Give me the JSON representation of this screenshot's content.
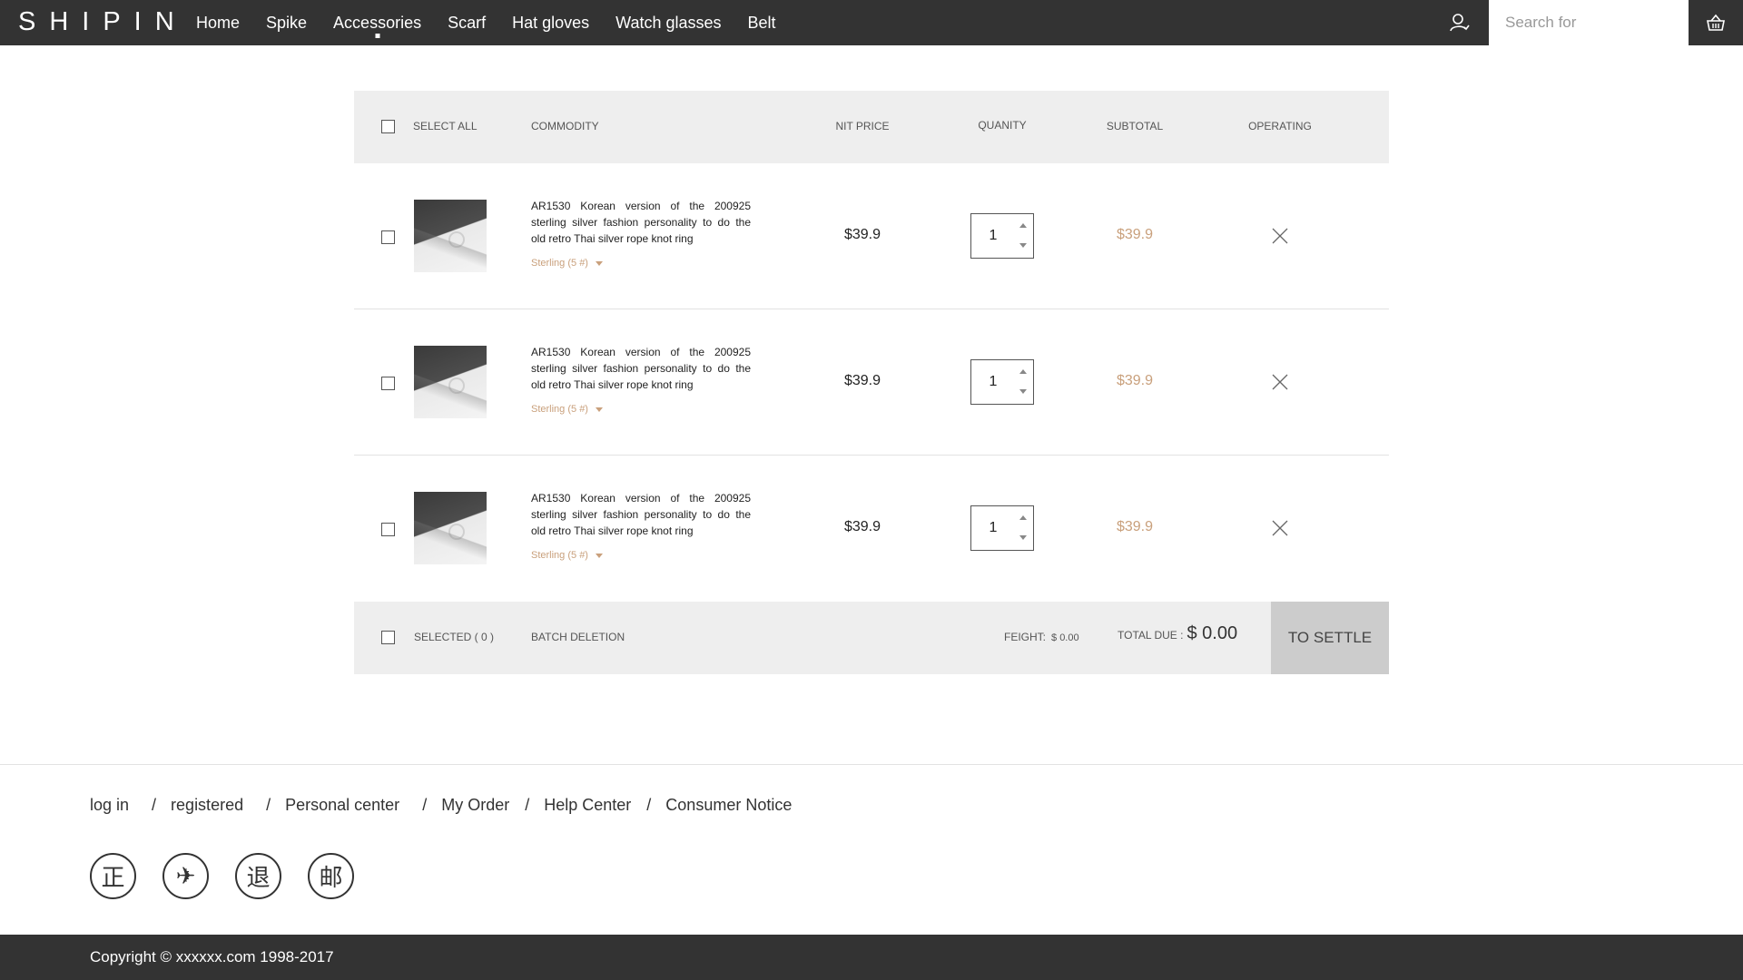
{
  "header": {
    "logo": "SHIPIN",
    "nav": [
      "Home",
      "Spike",
      "Accessories",
      "Scarf",
      "Hat gloves",
      "Watch glasses",
      "Belt"
    ],
    "active_nav": "Accessories",
    "search_placeholder": "Search for",
    "user_icon": "user-icon",
    "cart_icon": "basket-icon"
  },
  "table": {
    "select_all": "SELECT ALL",
    "commodity": "COMMODITY",
    "unit_price": "NIT PRICE",
    "quantity": "QUANITY",
    "subtotal": "SUBTOTAL",
    "operating": "OPERATING"
  },
  "items": [
    {
      "title": "AR1530 Korean version of the 200925 sterling silver fashion personality to do the old retro Thai silver rope knot ring",
      "variant": "Sterling (5 #)",
      "price": "$39.9",
      "quantity": "1",
      "subtotal": "$39.9",
      "checked": false
    },
    {
      "title": "AR1530 Korean version of the 200925 sterling silver fashion personality to do the old retro Thai silver rope knot ring",
      "variant": "Sterling (5 #)",
      "price": "$39.9",
      "quantity": "1",
      "subtotal": "$39.9",
      "checked": false
    },
    {
      "title": "AR1530 Korean version of the 200925 sterling silver fashion personality to do the old retro Thai silver rope knot ring",
      "variant": "Sterling (5 #)",
      "price": "$39.9",
      "quantity": "1",
      "subtotal": "$39.9",
      "checked": false
    }
  ],
  "summary": {
    "selected": "SELECTED ( 0 )",
    "batch_delete": "BATCH DELETION",
    "freight_label": "FEIGHT:",
    "freight_value": "$ 0.00",
    "total_label": "TOTAL  DUE :",
    "total_value": "$ 0.00",
    "settle": "TO  SETTLE"
  },
  "footer": {
    "links": [
      "log in",
      "registered",
      "Personal center",
      "My Order",
      "Help Center",
      "Consumer Notice"
    ],
    "badges": [
      "正",
      "✈",
      "退",
      "邮"
    ],
    "copyright": "Copyright © xxxxxx.com 1998-2017"
  },
  "colors": {
    "header_bg": "#333333",
    "accent_price": "#c9a07c",
    "panel_bg": "#eeeeee",
    "settle_bg": "#cccccc"
  }
}
